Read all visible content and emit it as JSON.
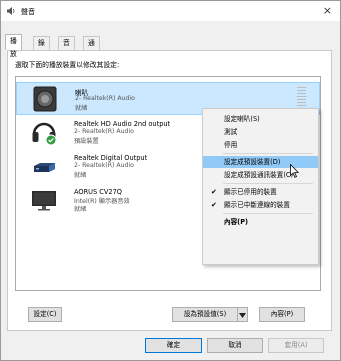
{
  "window": {
    "title": "聲音",
    "close_glyph": "×"
  },
  "tabs": [
    {
      "label": "播放",
      "active": true
    },
    {
      "label": "錄製",
      "active": false
    },
    {
      "label": "音效",
      "active": false
    },
    {
      "label": "通訊",
      "active": false
    }
  ],
  "prompt": "選取下面的播放裝置以修改其設定:",
  "devices": [
    {
      "name": "喇叭",
      "line2": "2- Realtek(R) Audio",
      "line3": "就緒",
      "icon": "speaker-icon",
      "selected": true
    },
    {
      "name": "Realtek HD Audio 2nd output",
      "line2": "2- Realtek(R) Audio",
      "line3": "預設裝置",
      "icon": "headphones-icon",
      "default_badge": true
    },
    {
      "name": "Realtek Digital Output",
      "line2": "2- Realtek(R) Audio",
      "line3": "就緒",
      "icon": "digital-output-icon"
    },
    {
      "name": "AORUS CV27Q",
      "line2": "Intel(R) 顯示器音效",
      "line3": "就緒",
      "icon": "monitor-icon"
    }
  ],
  "context_menu": {
    "items": [
      {
        "label": "設定喇叭(S)"
      },
      {
        "label": "測試"
      },
      {
        "label": "停用"
      },
      {
        "label": "設定成預設裝置(D)",
        "highlighted": true
      },
      {
        "label": "設定成預設通訊裝置(C)"
      },
      {
        "label": "顯示已停用的裝置",
        "checked": true
      },
      {
        "label": "顯示已中斷連線的裝置",
        "checked": true
      },
      {
        "label": "內容(P)"
      }
    ],
    "check_glyph": "✔"
  },
  "buttons": {
    "configure": "設定(C)",
    "set_default": "設為預設值(S)",
    "properties": "內容(P)",
    "ok": "確定",
    "cancel": "取消",
    "apply": "套用(A)"
  },
  "colors": {
    "selection": "#cce8ff",
    "menu_highlight": "#91c9f7",
    "default_badge": "#2e9b3d"
  }
}
